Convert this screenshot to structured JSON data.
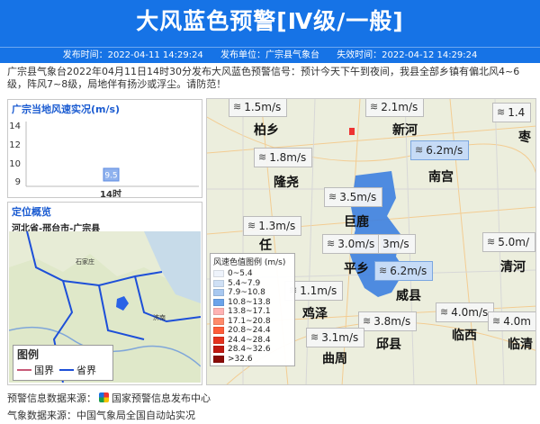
{
  "header": {
    "title": "大风蓝色预警[Ⅳ级/一般]",
    "published_label": "发布时间：2022-04-11 14:29:24",
    "unit_label": "发布单位：广宗县气象台",
    "expiry_label": "失效时间：2022-04-12 14:29:24"
  },
  "description": "广宗县气象台2022年04月11日14时30分发布大风蓝色预警信号：预计今天下午到夜间，我县全部乡镇有偏北风4~6级，阵风7~8级，局地伴有扬沙或浮尘。请防范！",
  "wind_chart": {
    "title": "广宗当地风速实况(m/s)",
    "yticks": [
      "14",
      "12",
      "10",
      "9"
    ],
    "point_label": "9.5",
    "x_label": "14时"
  },
  "location": {
    "title": "定位概览",
    "path": "河北省-邢台市-广宗县",
    "map_labels": {
      "shijiazhuang": "石家庄",
      "jinan": "济南"
    },
    "legend_title": "图例",
    "legend_items": [
      {
        "label": "国界",
        "color": "#c75a78"
      },
      {
        "label": "省界",
        "color": "#1d4fd8"
      }
    ]
  },
  "main_map": {
    "wind_labels": [
      {
        "text": "1.5m/s",
        "hi": false
      },
      {
        "text": "2.1m/s",
        "hi": false
      },
      {
        "text": "1.4",
        "hi": false
      },
      {
        "text": "1.8m/s",
        "hi": false
      },
      {
        "text": "6.2m/s",
        "hi": true
      },
      {
        "text": "3.5m/s",
        "hi": false
      },
      {
        "text": "1.3m/s",
        "hi": false
      },
      {
        "text": "3.0m/s",
        "hi": false
      },
      {
        "text": "3m/s",
        "hi": false
      },
      {
        "text": "5.0m/",
        "hi": false
      },
      {
        "text": "6.2m/s",
        "hi": true
      },
      {
        "text": "1.1m/s",
        "hi": false
      },
      {
        "text": "3.8m/s",
        "hi": false
      },
      {
        "text": "4.0m/s",
        "hi": false
      },
      {
        "text": "4.0m",
        "hi": false
      },
      {
        "text": "3.1m/s",
        "hi": false
      }
    ],
    "towns": [
      "柏乡",
      "新河",
      "枣",
      "隆尧",
      "南宫",
      "巨鹿",
      "任",
      "平乡",
      "清河",
      "威县",
      "鸡泽",
      "临西",
      "邱县",
      "曲周",
      "临清"
    ],
    "scale": {
      "title": "风速色值图例 (m/s)",
      "rows": [
        {
          "label": "0~5.4",
          "color": "#eef3fb"
        },
        {
          "label": "5.4~7.9",
          "color": "#cfe0f5"
        },
        {
          "label": "7.9~10.8",
          "color": "#a8c8f0"
        },
        {
          "label": "10.8~13.8",
          "color": "#6aa3ea"
        },
        {
          "label": "13.8~17.1",
          "color": "#ffb3b3"
        },
        {
          "label": "17.1~20.8",
          "color": "#ff8a6a"
        },
        {
          "label": "20.8~24.4",
          "color": "#ff5d3a"
        },
        {
          "label": "24.4~28.4",
          "color": "#e5331f"
        },
        {
          "label": "28.4~32.6",
          "color": "#c01a12"
        },
        {
          "label": ">32.6",
          "color": "#8a0c08"
        }
      ]
    }
  },
  "footer": {
    "warning_source": "预警信息数据来源：",
    "warning_source_name": "国家预警信息发布中心",
    "weather_source": "气象数据来源：中国气象局全国自动站实况"
  },
  "colors": {
    "brand": "#1673e6",
    "highlight_region": "#3d7fe0"
  }
}
